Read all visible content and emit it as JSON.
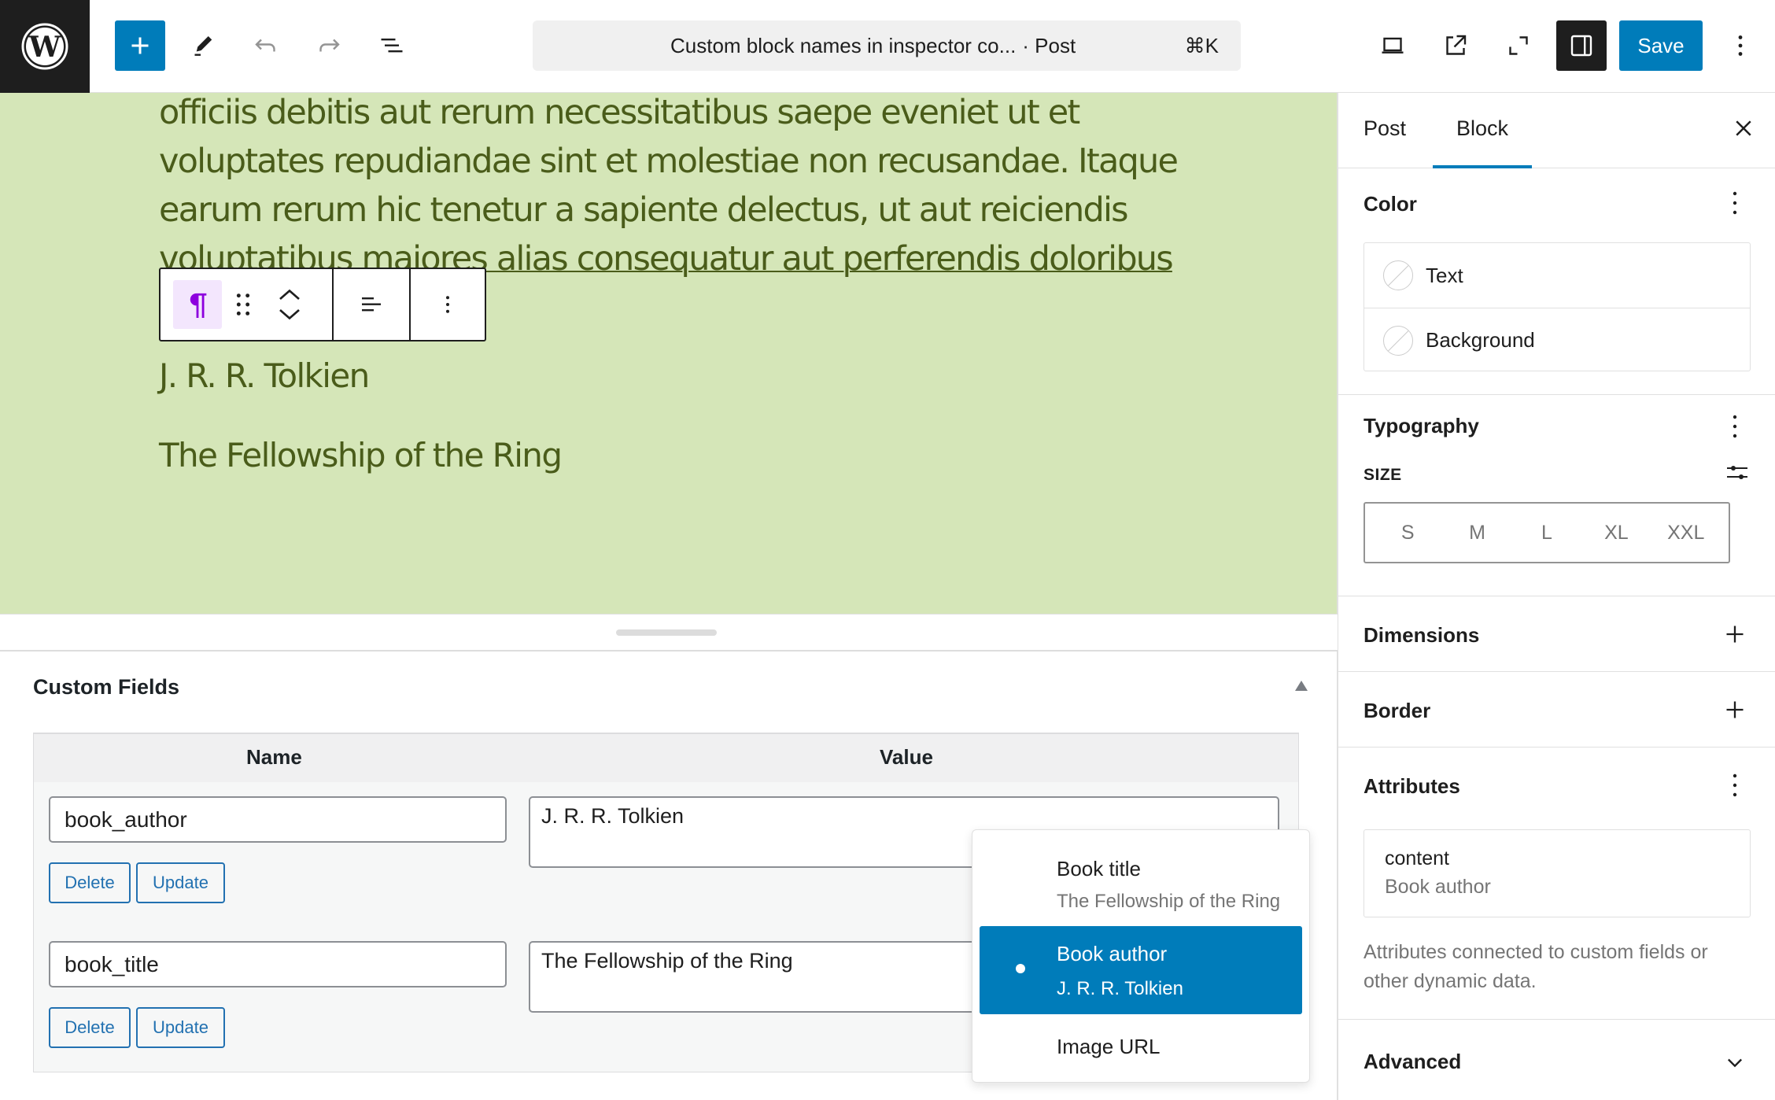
{
  "topbar": {
    "logo_icon": "wordpress-logo",
    "inserter_icon": "plus-icon",
    "tools_icon": "pencil-icon",
    "undo_icon": "undo-icon",
    "redo_icon": "redo-icon",
    "outline_icon": "list-view-icon",
    "command": {
      "title": "Custom block names in inspector co...",
      "type": "· Post",
      "shortcut": "⌘K"
    },
    "view_icon": "desktop-icon",
    "preview_icon": "external-link-icon",
    "fullscreen_icon": "fullscreen-icon",
    "settings_icon": "sidebar-toggle-icon",
    "save_label": "Save",
    "options_icon": "more-vertical-icon"
  },
  "canvas": {
    "background_color": "#d5e6b8",
    "text_color": "#4a5c1a",
    "paragraph_lines": [
      "officiis debitis aut rerum necessitatibus saepe eveniet ut et",
      "voluptates repudiandae sint et molestiae non recusandae. Itaque",
      "earum rerum hic tenetur a sapiente delectus, ut aut reiciendis",
      "voluptatibus maiores alias consequatur aut perferendis doloribus"
    ],
    "block_toolbar": {
      "block_type_icon": "paragraph-icon",
      "drag_icon": "drag-handle-icon",
      "move_icon": "move-up-down-icon",
      "align_icon": "align-left-icon",
      "more_icon": "more-vertical-icon"
    },
    "author_text": "J. R. R. Tolkien",
    "title_text": "The Fellowship of the Ring"
  },
  "custom_fields": {
    "heading": "Custom Fields",
    "columns": [
      "Name",
      "Value"
    ],
    "rows": [
      {
        "name": "book_author",
        "value": "J. R. R. Tolkien",
        "delete_label": "Delete",
        "update_label": "Update"
      },
      {
        "name": "book_title",
        "value": "The Fellowship of the Ring",
        "delete_label": "Delete",
        "update_label": "Update"
      }
    ]
  },
  "dropdown": {
    "items": [
      {
        "label": "Book title",
        "sublabel": "The Fellowship of the Ring",
        "selected": false
      },
      {
        "label": "Book author",
        "sublabel": "J. R. R. Tolkien",
        "selected": true
      },
      {
        "label": "Image URL",
        "sublabel": "",
        "selected": false
      }
    ],
    "selected_color": "#007cba"
  },
  "sidebar": {
    "tabs": [
      {
        "label": "Post",
        "active": false
      },
      {
        "label": "Block",
        "active": true
      }
    ],
    "accent_color": "#007cba",
    "color": {
      "title": "Color",
      "items": [
        "Text",
        "Background"
      ]
    },
    "typography": {
      "title": "Typography",
      "size_label": "SIZE",
      "sizes": [
        "S",
        "M",
        "L",
        "XL",
        "XXL"
      ]
    },
    "dimensions": {
      "title": "Dimensions"
    },
    "border": {
      "title": "Border"
    },
    "attributes": {
      "title": "Attributes",
      "attr_name": "content",
      "attr_value": "Book author",
      "help": "Attributes connected to custom fields or other dynamic data."
    },
    "advanced": {
      "title": "Advanced"
    }
  }
}
